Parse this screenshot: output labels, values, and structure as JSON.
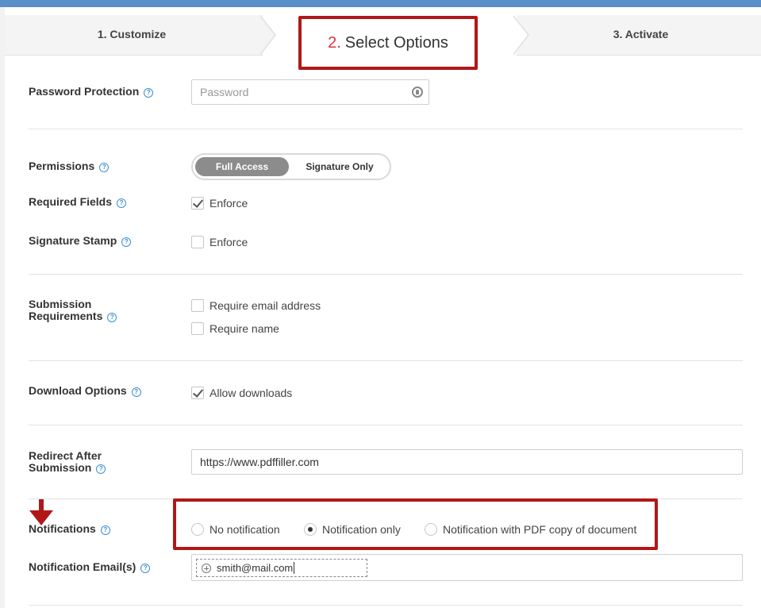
{
  "wizard": {
    "steps": [
      {
        "label": "1. Customize"
      },
      {
        "number": "2.",
        "label": "Select Options"
      },
      {
        "label": "3. Activate"
      }
    ]
  },
  "password_protection": {
    "label": "Password Protection",
    "placeholder": "Password"
  },
  "permissions": {
    "label": "Permissions",
    "options": [
      "Full Access",
      "Signature Only"
    ],
    "selected": "Full Access"
  },
  "required_fields": {
    "label": "Required Fields",
    "checkbox_label": "Enforce",
    "checked": true
  },
  "signature_stamp": {
    "label": "Signature Stamp",
    "checkbox_label": "Enforce",
    "checked": false
  },
  "submission_requirements": {
    "label_line1": "Submission",
    "label_line2": "Requirements",
    "options": [
      {
        "label": "Require email address",
        "checked": false
      },
      {
        "label": "Require name",
        "checked": false
      }
    ]
  },
  "download_options": {
    "label": "Download Options",
    "checkbox_label": "Allow downloads",
    "checked": true
  },
  "redirect": {
    "label_line1": "Redirect After",
    "label_line2": "Submission",
    "value": "https://www.pdffiller.com"
  },
  "notifications": {
    "label": "Notifications",
    "options": [
      "No notification",
      "Notification only",
      "Notification with PDF copy of document"
    ],
    "selected": "Notification only"
  },
  "notification_emails": {
    "label": "Notification Email(s)",
    "emails": [
      "smith@mail.com"
    ]
  },
  "colors": {
    "accent_bar": "#5b8fc9",
    "highlight_red": "#b01818",
    "help_icon": "#3b8fd4",
    "step_number_red": "#d9363e"
  }
}
